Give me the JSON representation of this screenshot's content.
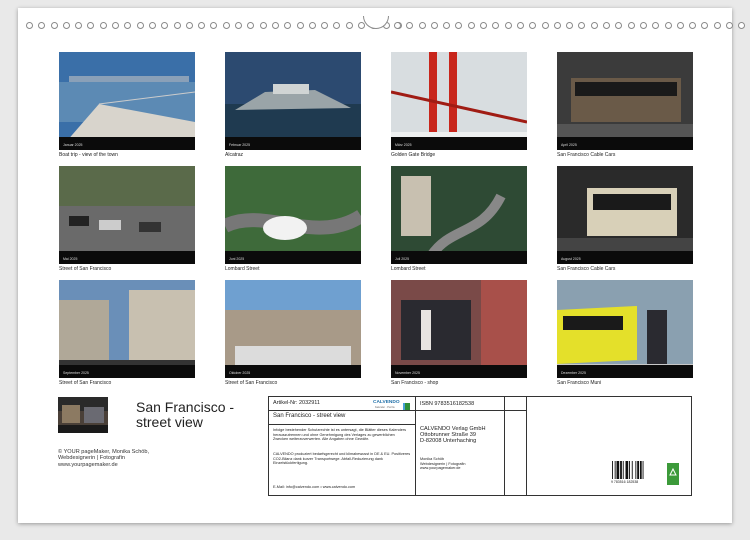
{
  "thumbnails": [
    {
      "month": "Januar 2025",
      "caption": "Boat trip - view of the town",
      "scene": "boat"
    },
    {
      "month": "Februar 2025",
      "caption": "Alcatraz",
      "scene": "island"
    },
    {
      "month": "März 2025",
      "caption": "Golden Gate Bridge",
      "scene": "bridge"
    },
    {
      "month": "April 2025",
      "caption": "San Francisco Cable Cars",
      "scene": "cablecar"
    },
    {
      "month": "Mai 2025",
      "caption": "Street of San Francisco",
      "scene": "street"
    },
    {
      "month": "Juni 2025",
      "caption": "Lombard Street",
      "scene": "lombard"
    },
    {
      "month": "Juli 2025",
      "caption": "Lombard Street",
      "scene": "lombard2"
    },
    {
      "month": "August 2025",
      "caption": "San Francisco Cable Cars",
      "scene": "cablecar2"
    },
    {
      "month": "September 2025",
      "caption": "Street of San Francisco",
      "scene": "street2"
    },
    {
      "month": "Oktober 2025",
      "caption": "Street of San Francisco",
      "scene": "street3"
    },
    {
      "month": "November 2025",
      "caption": "San Francisco - shop",
      "scene": "shop"
    },
    {
      "month": "Dezember 2025",
      "caption": "San Francisco Muni",
      "scene": "tram"
    }
  ],
  "title_line1": "San Francisco  -",
  "title_line2": "street view",
  "left_info": [
    "© YOUR pageMaker,  Monika Schöb,",
    "Webdesignerin | Fotografin",
    "www.yourpagemaker.de"
  ],
  "panel": {
    "article": "Artikel-Nr: 2032911",
    "logo_text": "CALVENDO",
    "logo_sub": "Kalender · Puzzle",
    "product_title": "San Francisco  -  street view",
    "legal": "Infolge bestehender Schutzrechte ist es untersagt, die Blätter dieses Kalenders herauszutrennen und ohne Genehmigung des Verlages zu gewerblichen Zwecken weiterzuverwerten. Alle Angaben ohne Gewähr.",
    "climate": "CALVENDO produziert bedarfsgerecht und klimabewusst in DE & EU. Positiveres CO2-Bilanz dank kurzer Transportwege. Abfall-Reduzierung dank Einzelstückfertigung.",
    "contact": "E-Mail: info@calvendo.com • www.calvendo.com",
    "isbn": "ISBN 9783516182538",
    "publisher": [
      "CALVENDO Verlag GmbH",
      "Ottobrunner Straße 39",
      "D-82008 Unterhaching"
    ],
    "author": [
      "Monika Schöb",
      "Webdesignerin | Fotografin",
      "www.yourpagemaker.de"
    ],
    "barcode_digits": "9 783516 182538"
  }
}
